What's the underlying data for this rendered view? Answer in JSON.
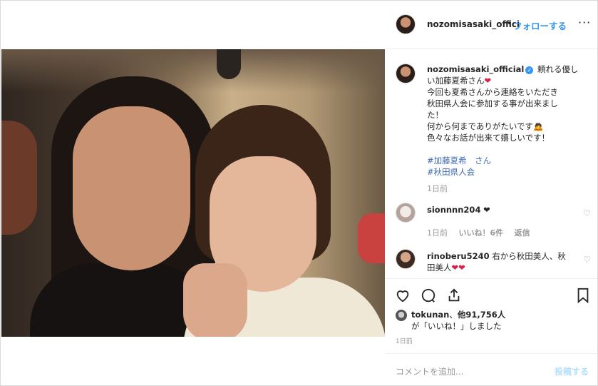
{
  "header": {
    "username": "nozomisasaki_offici",
    "dot": "•",
    "follow_label": "フォローする",
    "more_label": "···"
  },
  "caption": {
    "username": "nozomisasaki_official",
    "verified_glyph": "✓",
    "line1": "頼れる優し",
    "line2": "い加藤夏希さん",
    "heart": "❤",
    "line3": "今回も夏希さんから連絡をいただき",
    "line4": "秋田県人会に参加する事が出来まし",
    "line5": "た！",
    "line6": "何から何までありがたいです",
    "line6_emoji": "🙇",
    "line7": "色々なお話が出来て嬉しいです！",
    "hashtag1": "#加藤夏希　さん",
    "hashtag2": "#秋田県人会",
    "time": "1日前"
  },
  "comments": [
    {
      "username": "sionnnn204",
      "text": "❤",
      "time": "1日前",
      "likes": "いいね！6件",
      "reply": "返信"
    },
    {
      "username": "rinoberu5240",
      "text": "右から秋田美人、秋田美人",
      "emoji": "❤❤"
    }
  ],
  "actions": {
    "like_icon": "heart-outline-icon",
    "comment_icon": "comment-icon",
    "share_icon": "share-icon",
    "save_icon": "bookmark-icon",
    "liked_by_user": "tokunan",
    "liked_by_sep": "、",
    "liked_others": "他91,756人",
    "liked_suffix": "が「いいね！」しました",
    "time": "1日前"
  },
  "comment_box": {
    "placeholder": "コメントを追加...",
    "post_label": "投稿する"
  },
  "colors": {
    "link_blue": "#3897f0",
    "hashtag_blue": "#3f6bb5",
    "muted_gray": "#999999",
    "heart_red": "#d4204a"
  }
}
